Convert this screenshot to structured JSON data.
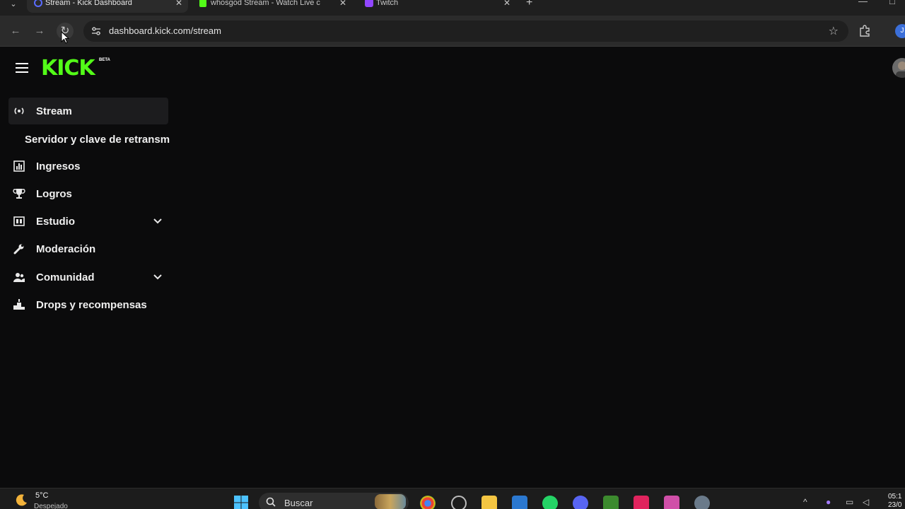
{
  "browser": {
    "tabs": [
      {
        "title": "Stream - Kick Dashboard",
        "active": true,
        "favicon_color": "#5a6cff"
      },
      {
        "title": "whosgod Stream - Watch Live c",
        "active": false,
        "favicon_color": "#53fc18"
      },
      {
        "title": "Twitch",
        "active": false,
        "favicon_color": "#9146ff"
      }
    ],
    "new_tab_label": "+",
    "url": "dashboard.kick.com/stream"
  },
  "header": {
    "logo_text": "KICK",
    "logo_badge": "BETA",
    "avatar_initial": "J"
  },
  "sidebar": {
    "items": [
      {
        "label": "Stream",
        "icon": "broadcast-icon",
        "active": true
      },
      {
        "label": "Servidor y clave de retransm",
        "sub": true
      },
      {
        "label": "Ingresos",
        "icon": "chart-icon"
      },
      {
        "label": "Logros",
        "icon": "trophy-icon"
      },
      {
        "label": "Estudio",
        "icon": "studio-icon",
        "expandable": true
      },
      {
        "label": "Moderación",
        "icon": "wrench-icon"
      },
      {
        "label": "Comunidad",
        "icon": "people-icon",
        "expandable": true
      },
      {
        "label": "Drops y recompensas",
        "icon": "podium-icon"
      }
    ]
  },
  "taskbar": {
    "weather_temp": "5°C",
    "weather_desc": "Despejado",
    "search_placeholder": "Buscar",
    "clock_time": "05:1",
    "clock_date": "23/0"
  },
  "colors": {
    "brand": "#53fc18",
    "background": "#0b0b0c",
    "active_item": "#1c1c1e"
  }
}
